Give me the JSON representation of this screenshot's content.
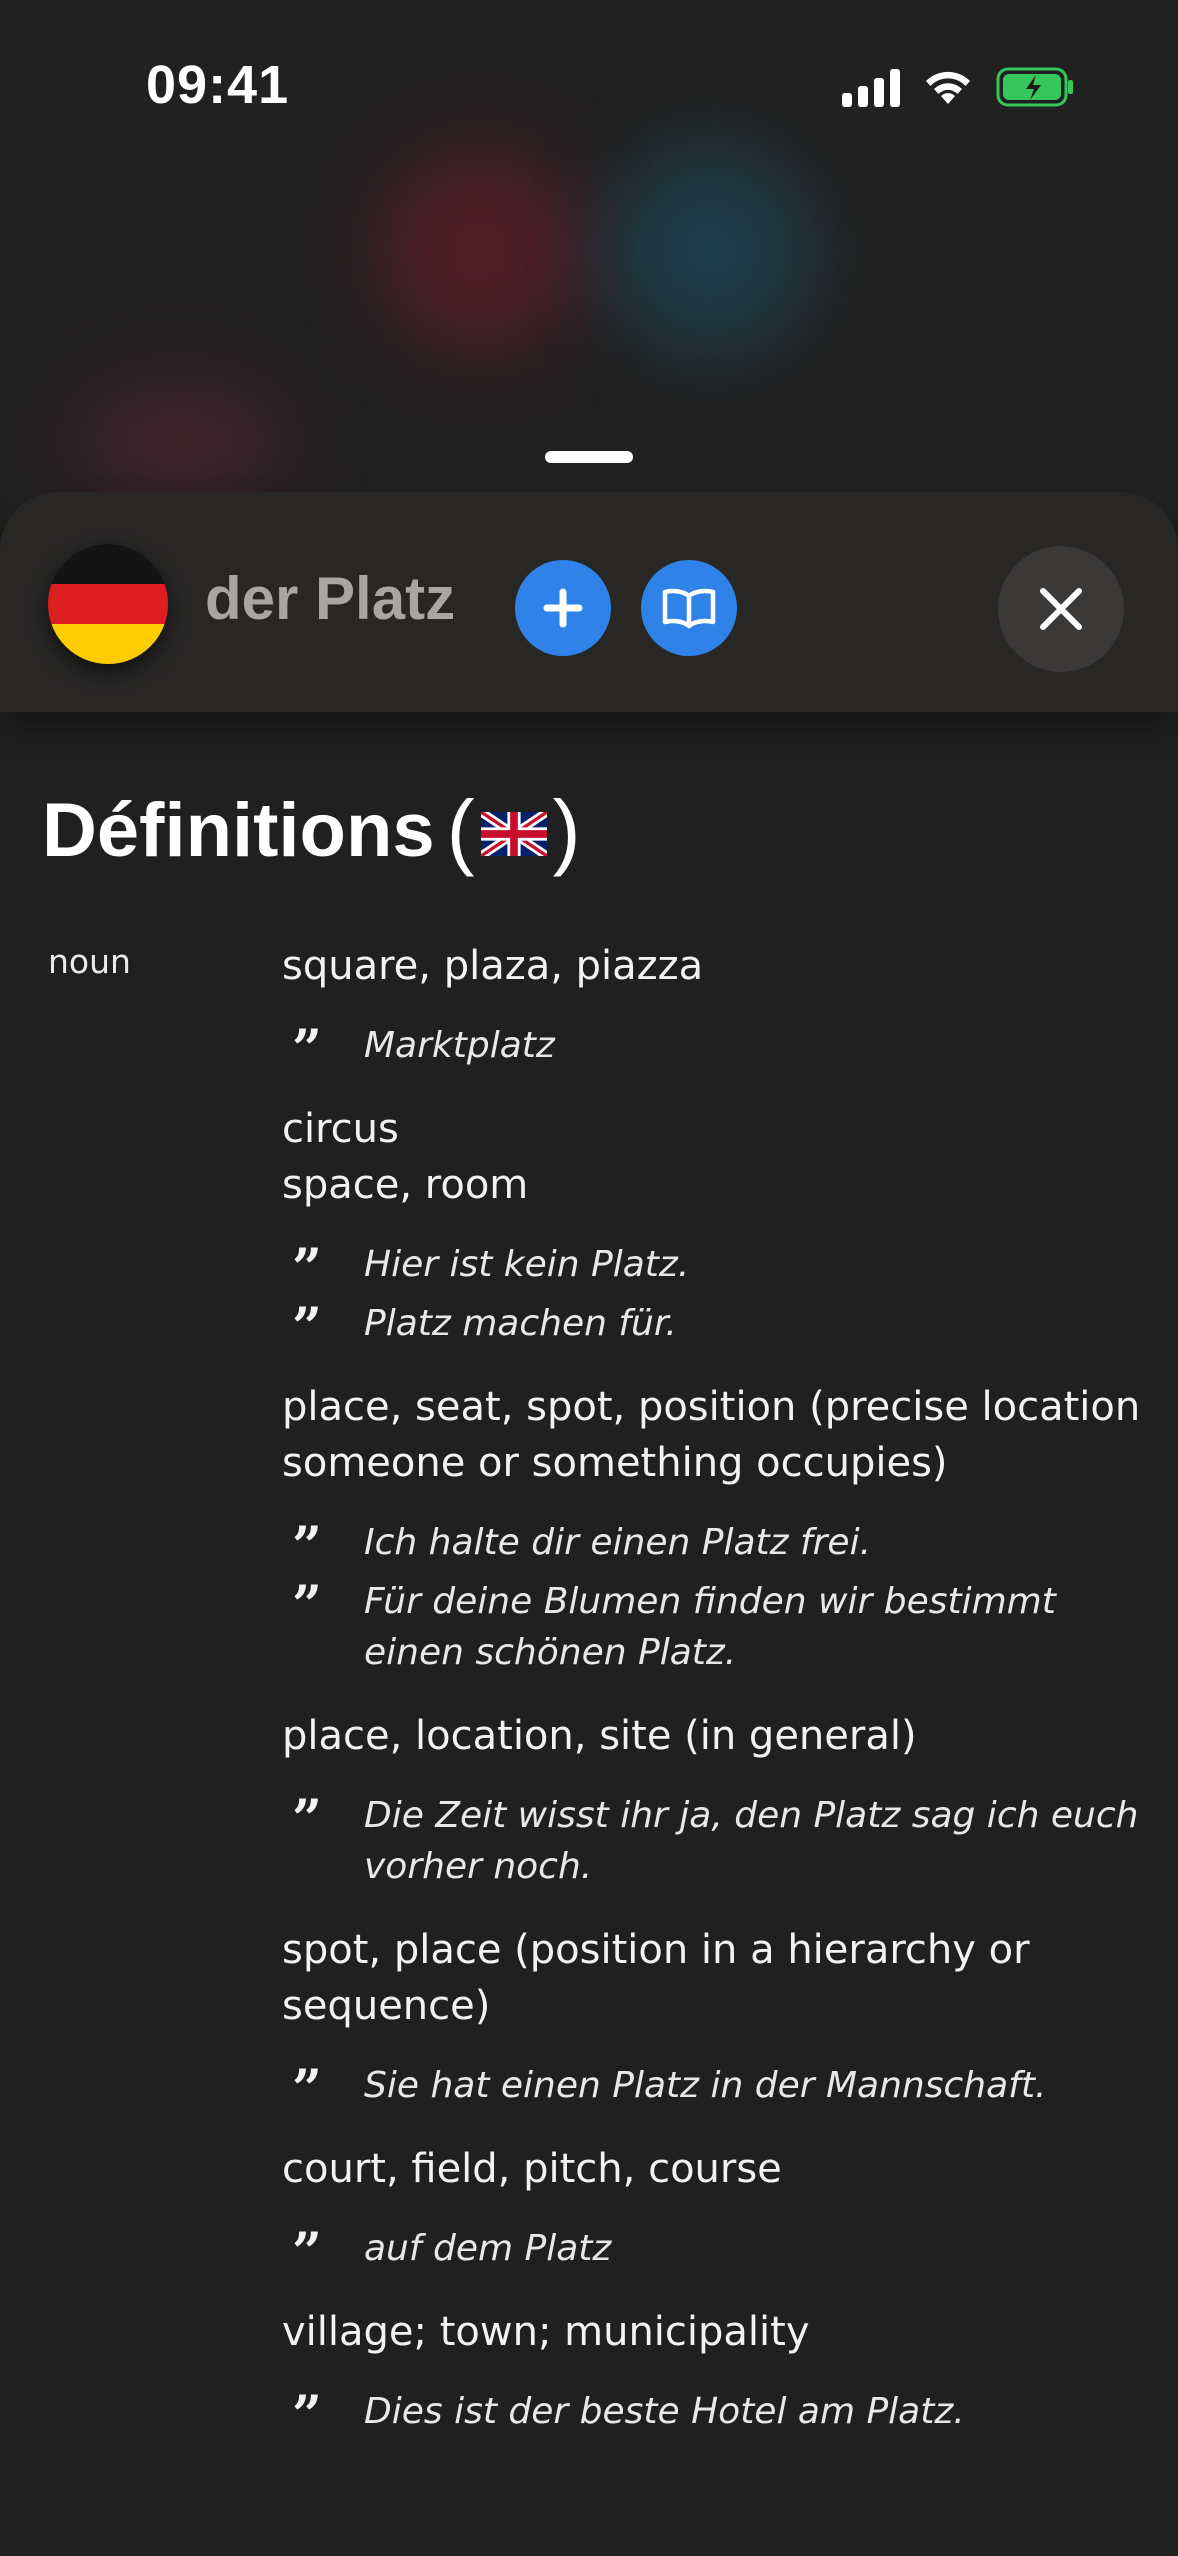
{
  "status_bar": {
    "time": "09:41"
  },
  "header": {
    "word": "der Platz",
    "language_flag": "germany-flag"
  },
  "section": {
    "title": "Définitions",
    "open_paren": "(",
    "close_paren": ")",
    "translation_flag": "uk-flag"
  },
  "part_of_speech": "noun",
  "definitions": [
    {
      "text": "square, plaza, piazza",
      "examples": [
        "Marktplatz"
      ]
    },
    {
      "text": "circus",
      "examples": []
    },
    {
      "text": "space, room",
      "examples": [
        "Hier ist kein Platz.",
        "Platz machen für."
      ]
    },
    {
      "text": "place, seat, spot, position (precise location someone or something occupies)",
      "examples": [
        "Ich halte dir einen Platz frei.",
        "Für deine Blumen finden wir bestimmt einen schönen Platz."
      ]
    },
    {
      "text": "place, location, site (in general)",
      "examples": [
        "Die Zeit wisst ihr ja, den Platz sag ich euch vorher noch."
      ]
    },
    {
      "text": "spot, place (position in a hierarchy or sequence)",
      "examples": [
        "Sie hat einen Platz in der Mannschaft."
      ]
    },
    {
      "text": "court, field, pitch, course",
      "examples": [
        "auf dem Platz"
      ]
    },
    {
      "text": "village; town; municipality",
      "examples": [
        "Dies ist der beste Hotel am Platz."
      ]
    }
  ],
  "colors": {
    "accent": "#2e82e8",
    "background": "#212020",
    "word": "#a8a5a2"
  },
  "icons": {
    "add": "plus-icon",
    "book": "book-icon",
    "close": "close-icon",
    "quote": "quote-icon"
  }
}
